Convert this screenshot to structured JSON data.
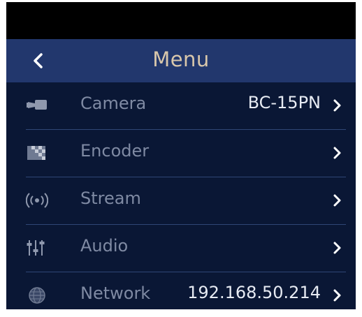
{
  "header": {
    "back_icon": "chevron-left-icon",
    "title": "Menu"
  },
  "menu": {
    "items": [
      {
        "icon": "camera-icon",
        "label": "Camera",
        "value": "BC-15PN"
      },
      {
        "icon": "encoder-icon",
        "label": "Encoder",
        "value": ""
      },
      {
        "icon": "stream-icon",
        "label": "Stream",
        "value": ""
      },
      {
        "icon": "audio-mixer-icon",
        "label": "Audio",
        "value": ""
      },
      {
        "icon": "globe-icon",
        "label": "Network",
        "value": "192.168.50.214"
      }
    ]
  },
  "colors": {
    "background": "#0a1735",
    "header": "#22376d",
    "title": "#d9c7ab",
    "label": "#7f8aa3",
    "value": "#e7ebf3"
  }
}
